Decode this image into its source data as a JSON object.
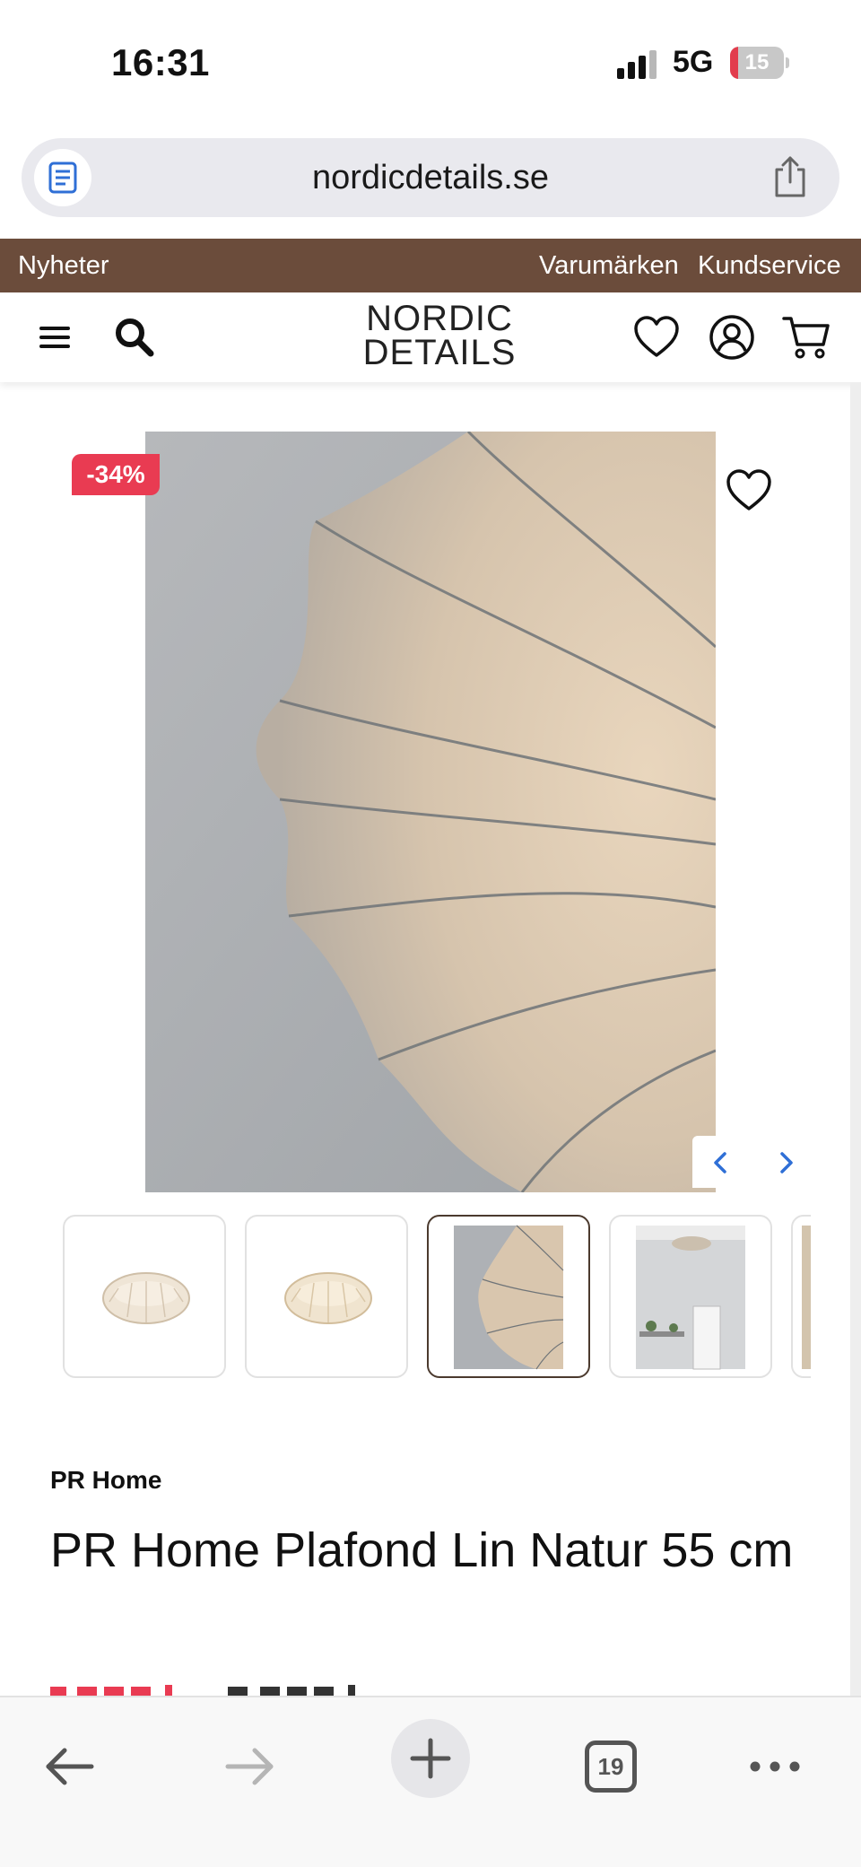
{
  "status_bar": {
    "time": "16:31",
    "network": "5G",
    "battery_level": "15",
    "battery_fraction": 0.15,
    "battery_color": "#e23d4d"
  },
  "browser": {
    "url": "nordicdetails.se",
    "reader_icon": "reader-mode-icon",
    "share_icon": "share-icon",
    "open_tabs_count": "19",
    "toolbar_icons": [
      "back-arrow-icon",
      "forward-arrow-icon",
      "plus-icon",
      "tabs-icon",
      "more-icon"
    ]
  },
  "top_bar": {
    "background": "#6b4c3b",
    "left_link": "Nyheter",
    "right_links": [
      "Varumärken",
      "Kundservice"
    ]
  },
  "header": {
    "logo_line1": "NORDIC",
    "logo_line2": "DETAILS",
    "icons": [
      "menu-icon",
      "search-icon",
      "heart-icon",
      "account-icon",
      "cart-icon"
    ]
  },
  "product": {
    "discount_badge": "-34%",
    "badge_color": "#e93b52",
    "brand": "PR Home",
    "title": "PR Home Plafond Lin Natur 55 cm",
    "gallery_thumbnail_count": 5,
    "active_thumbnail_index": 2
  }
}
